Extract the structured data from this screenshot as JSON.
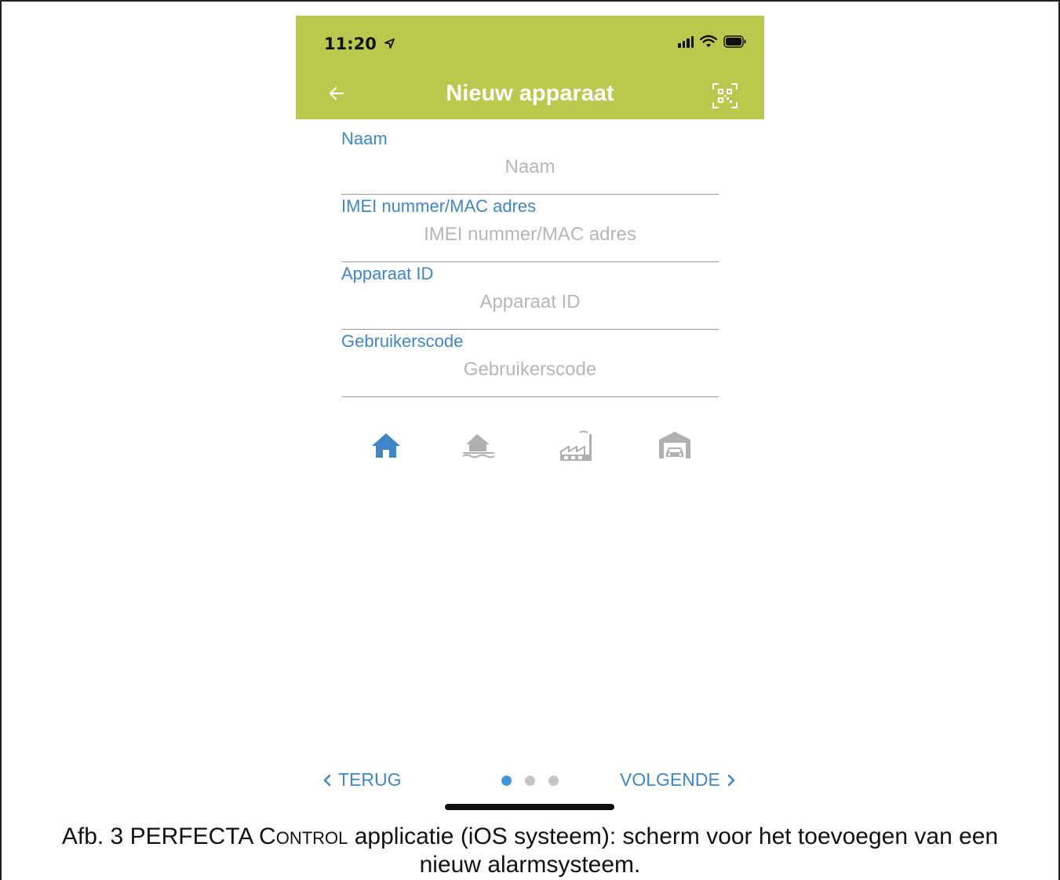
{
  "status_bar": {
    "time": "11:20",
    "location_icon": "location-arrow-icon",
    "signal_icon": "cellular-signal-icon",
    "wifi_icon": "wifi-icon",
    "battery_icon": "battery-icon"
  },
  "nav": {
    "back_icon": "arrow-left-icon",
    "title": "Nieuw apparaat",
    "qr_icon": "qr-scan-icon",
    "background": "#b9c94d"
  },
  "form": {
    "fields": [
      {
        "label": "Naam",
        "placeholder": "Naam",
        "value": ""
      },
      {
        "label": "IMEI nummer/MAC adres",
        "placeholder": "IMEI nummer/MAC adres",
        "value": ""
      },
      {
        "label": "Apparaat ID",
        "placeholder": "Apparaat ID",
        "value": ""
      },
      {
        "label": "Gebruikerscode",
        "placeholder": "Gebruikerscode",
        "value": ""
      }
    ]
  },
  "object_types": [
    {
      "icon": "house-icon",
      "selected": true
    },
    {
      "icon": "house-by-water-icon",
      "selected": false
    },
    {
      "icon": "factory-icon",
      "selected": false
    },
    {
      "icon": "garage-icon",
      "selected": false
    }
  ],
  "colors": {
    "accent": "#3f86c8",
    "inactive": "#b0b0b0",
    "header": "#b9c94d"
  },
  "pager": {
    "back_label": "TERUG",
    "next_label": "VOLGENDE",
    "pages": 3,
    "current_page": 1
  },
  "caption": {
    "prefix": "Afb. 3 PERFECTA C",
    "smallcaps": "ONTROL",
    "suffix": " applicatie (iOS systeem): scherm voor het toevoegen van een",
    "line2": "nieuw alarmsysteem."
  }
}
